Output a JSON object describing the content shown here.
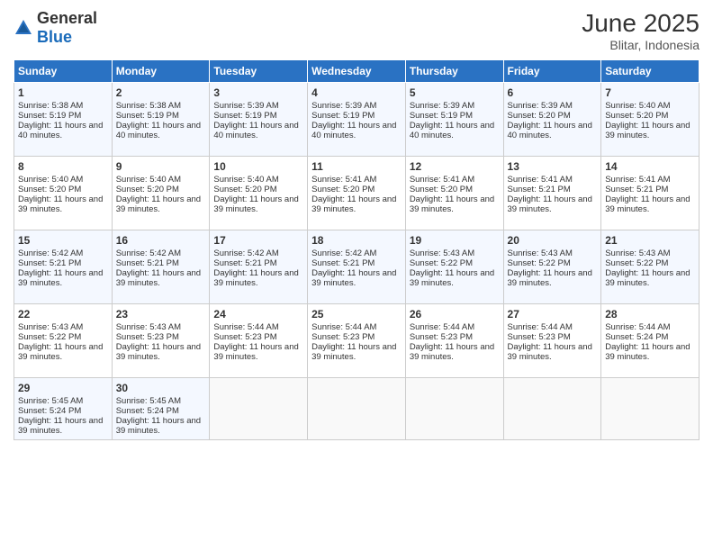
{
  "header": {
    "logo_general": "General",
    "logo_blue": "Blue",
    "month_year": "June 2025",
    "location": "Blitar, Indonesia"
  },
  "days_of_week": [
    "Sunday",
    "Monday",
    "Tuesday",
    "Wednesday",
    "Thursday",
    "Friday",
    "Saturday"
  ],
  "weeks": [
    [
      {
        "day": "1",
        "sunrise": "5:38 AM",
        "sunset": "5:19 PM",
        "daylight": "11 hours and 40 minutes."
      },
      {
        "day": "2",
        "sunrise": "5:38 AM",
        "sunset": "5:19 PM",
        "daylight": "11 hours and 40 minutes."
      },
      {
        "day": "3",
        "sunrise": "5:39 AM",
        "sunset": "5:19 PM",
        "daylight": "11 hours and 40 minutes."
      },
      {
        "day": "4",
        "sunrise": "5:39 AM",
        "sunset": "5:19 PM",
        "daylight": "11 hours and 40 minutes."
      },
      {
        "day": "5",
        "sunrise": "5:39 AM",
        "sunset": "5:19 PM",
        "daylight": "11 hours and 40 minutes."
      },
      {
        "day": "6",
        "sunrise": "5:39 AM",
        "sunset": "5:20 PM",
        "daylight": "11 hours and 40 minutes."
      },
      {
        "day": "7",
        "sunrise": "5:40 AM",
        "sunset": "5:20 PM",
        "daylight": "11 hours and 39 minutes."
      }
    ],
    [
      {
        "day": "8",
        "sunrise": "5:40 AM",
        "sunset": "5:20 PM",
        "daylight": "11 hours and 39 minutes."
      },
      {
        "day": "9",
        "sunrise": "5:40 AM",
        "sunset": "5:20 PM",
        "daylight": "11 hours and 39 minutes."
      },
      {
        "day": "10",
        "sunrise": "5:40 AM",
        "sunset": "5:20 PM",
        "daylight": "11 hours and 39 minutes."
      },
      {
        "day": "11",
        "sunrise": "5:41 AM",
        "sunset": "5:20 PM",
        "daylight": "11 hours and 39 minutes."
      },
      {
        "day": "12",
        "sunrise": "5:41 AM",
        "sunset": "5:20 PM",
        "daylight": "11 hours and 39 minutes."
      },
      {
        "day": "13",
        "sunrise": "5:41 AM",
        "sunset": "5:21 PM",
        "daylight": "11 hours and 39 minutes."
      },
      {
        "day": "14",
        "sunrise": "5:41 AM",
        "sunset": "5:21 PM",
        "daylight": "11 hours and 39 minutes."
      }
    ],
    [
      {
        "day": "15",
        "sunrise": "5:42 AM",
        "sunset": "5:21 PM",
        "daylight": "11 hours and 39 minutes."
      },
      {
        "day": "16",
        "sunrise": "5:42 AM",
        "sunset": "5:21 PM",
        "daylight": "11 hours and 39 minutes."
      },
      {
        "day": "17",
        "sunrise": "5:42 AM",
        "sunset": "5:21 PM",
        "daylight": "11 hours and 39 minutes."
      },
      {
        "day": "18",
        "sunrise": "5:42 AM",
        "sunset": "5:21 PM",
        "daylight": "11 hours and 39 minutes."
      },
      {
        "day": "19",
        "sunrise": "5:43 AM",
        "sunset": "5:22 PM",
        "daylight": "11 hours and 39 minutes."
      },
      {
        "day": "20",
        "sunrise": "5:43 AM",
        "sunset": "5:22 PM",
        "daylight": "11 hours and 39 minutes."
      },
      {
        "day": "21",
        "sunrise": "5:43 AM",
        "sunset": "5:22 PM",
        "daylight": "11 hours and 39 minutes."
      }
    ],
    [
      {
        "day": "22",
        "sunrise": "5:43 AM",
        "sunset": "5:22 PM",
        "daylight": "11 hours and 39 minutes."
      },
      {
        "day": "23",
        "sunrise": "5:43 AM",
        "sunset": "5:23 PM",
        "daylight": "11 hours and 39 minutes."
      },
      {
        "day": "24",
        "sunrise": "5:44 AM",
        "sunset": "5:23 PM",
        "daylight": "11 hours and 39 minutes."
      },
      {
        "day": "25",
        "sunrise": "5:44 AM",
        "sunset": "5:23 PM",
        "daylight": "11 hours and 39 minutes."
      },
      {
        "day": "26",
        "sunrise": "5:44 AM",
        "sunset": "5:23 PM",
        "daylight": "11 hours and 39 minutes."
      },
      {
        "day": "27",
        "sunrise": "5:44 AM",
        "sunset": "5:23 PM",
        "daylight": "11 hours and 39 minutes."
      },
      {
        "day": "28",
        "sunrise": "5:44 AM",
        "sunset": "5:24 PM",
        "daylight": "11 hours and 39 minutes."
      }
    ],
    [
      {
        "day": "29",
        "sunrise": "5:45 AM",
        "sunset": "5:24 PM",
        "daylight": "11 hours and 39 minutes."
      },
      {
        "day": "30",
        "sunrise": "5:45 AM",
        "sunset": "5:24 PM",
        "daylight": "11 hours and 39 minutes."
      },
      null,
      null,
      null,
      null,
      null
    ]
  ]
}
